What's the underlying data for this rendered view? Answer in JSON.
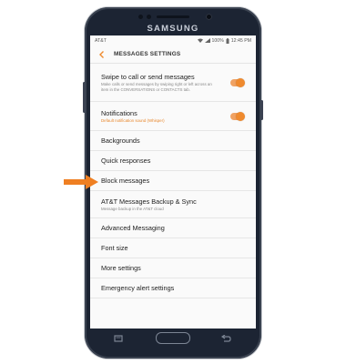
{
  "device": {
    "brand": "SAMSUNG"
  },
  "statusbar": {
    "carrier": "AT&T",
    "battery": "100%",
    "time": "12:45 PM"
  },
  "header": {
    "title": "MESSAGES SETTINGS"
  },
  "settings": {
    "swipe": {
      "title": "Swipe to call or send messages",
      "subtitle": "Make calls or send messages by swiping right or left across an item in the CONVERSATIONS or CONTACTS tab.",
      "enabled": true
    },
    "notifications": {
      "title": "Notifications",
      "subtitle": "Default notification sound (Whisper)",
      "enabled": true
    },
    "items": [
      "Backgrounds",
      "Quick responses",
      "Block messages"
    ],
    "backup": {
      "title": "AT&T Messages Backup & Sync",
      "subtitle": "Message backup in the AT&T cloud"
    },
    "items2": [
      "Advanced Messaging",
      "Font size",
      "More settings",
      "Emergency alert settings"
    ]
  },
  "colors": {
    "accent": "#ef8a2e",
    "phone": "#1c2433",
    "callout": "#ef7f22"
  },
  "icons": [
    "back-arrow-icon",
    "wifi-icon",
    "signal-icon",
    "battery-icon",
    "recents-icon",
    "home-button",
    "back-key-icon",
    "callout-arrow-icon"
  ]
}
